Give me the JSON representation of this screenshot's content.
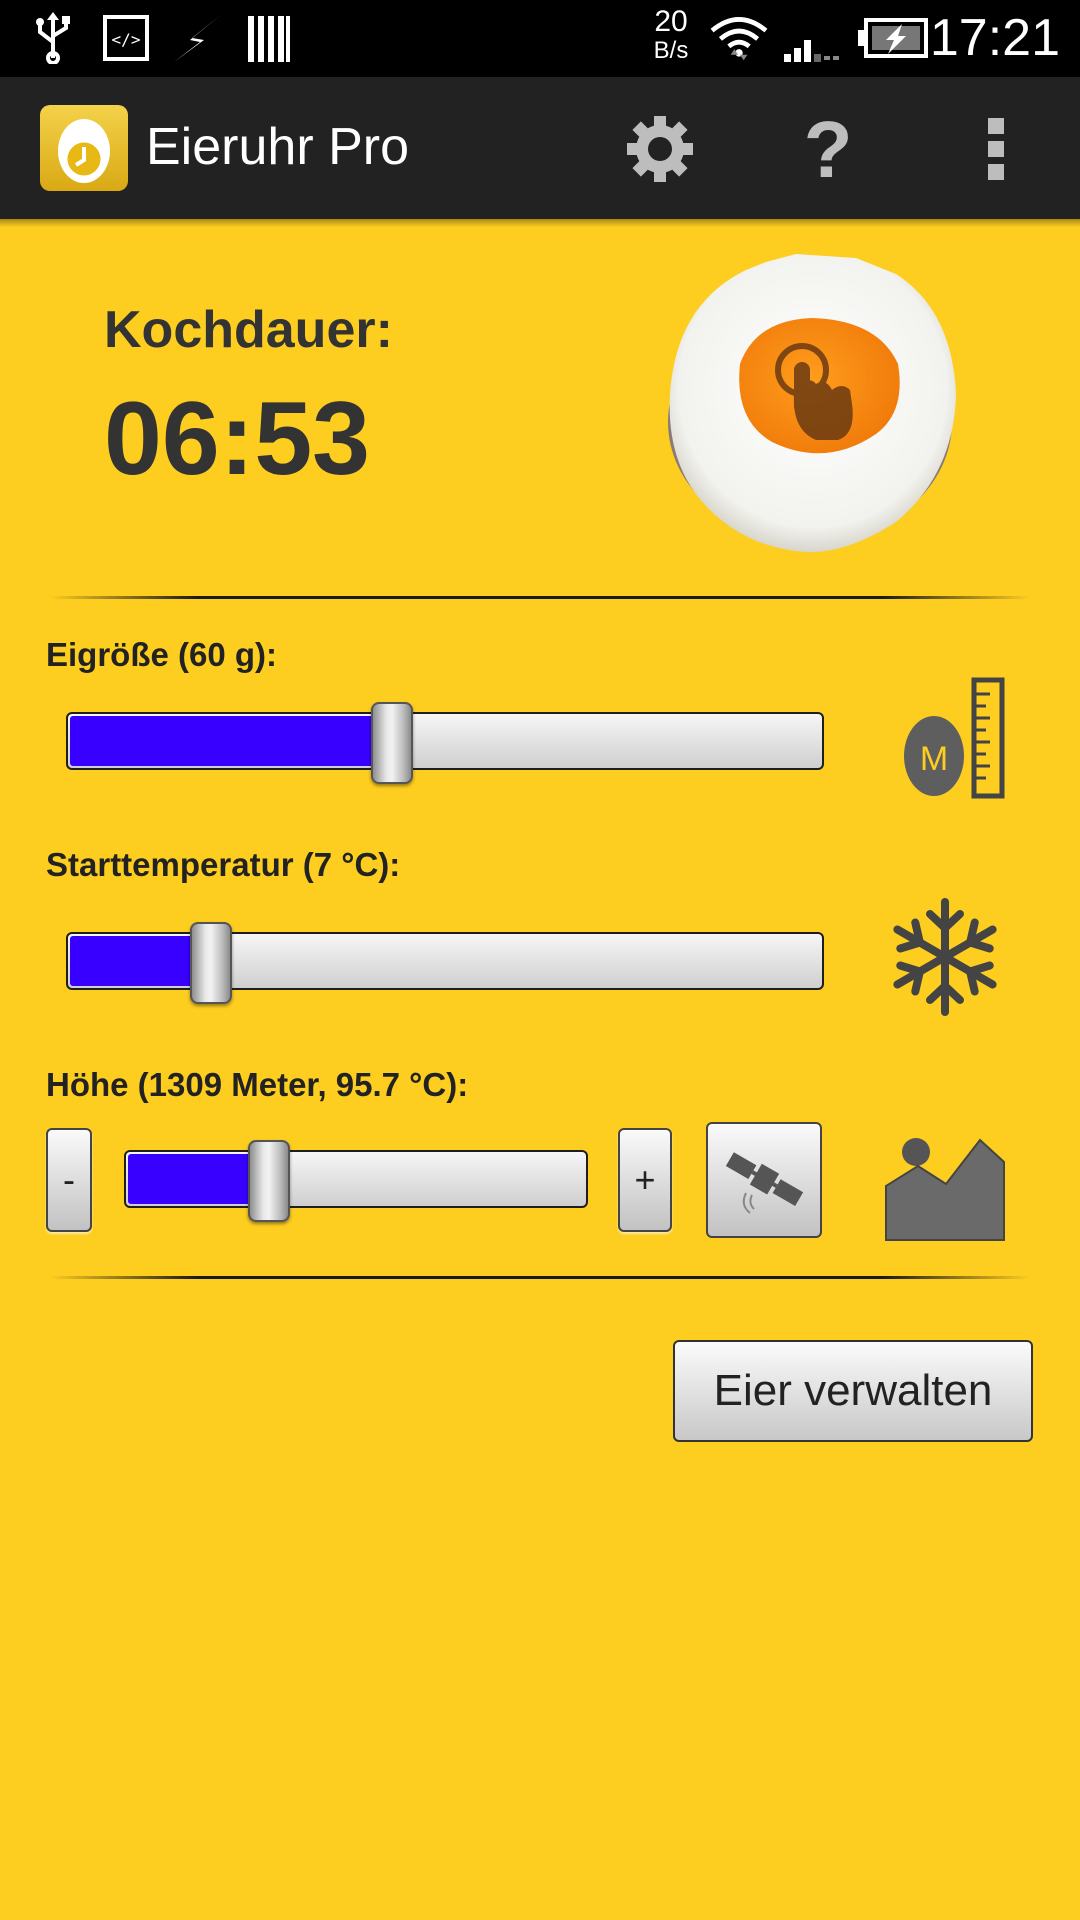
{
  "status_bar": {
    "data_rate_value": "20",
    "data_rate_unit": "B/s",
    "time": "17:21",
    "icons": [
      "usb-icon",
      "code-icon",
      "flash-icon",
      "barcode-icon",
      "wifi-icon",
      "signal-icon",
      "battery-icon"
    ]
  },
  "action_bar": {
    "title": "Eieruhr Pro",
    "icons": [
      "app-icon",
      "settings-gear-icon",
      "help-icon",
      "overflow-menu-icon"
    ]
  },
  "cooking": {
    "label": "Kochdauer:",
    "time": "06:53"
  },
  "settings": {
    "egg_size": {
      "label": "Eigröße (60 g):",
      "slider_fraction": 0.43,
      "icon_letter": "M"
    },
    "start_temp": {
      "label": "Starttemperatur (7 °C):",
      "slider_fraction": 0.19
    },
    "altitude": {
      "label": "Höhe (1309 Meter, 95.7 °C):",
      "slider_fraction": 0.31,
      "minus_label": "-",
      "plus_label": "+"
    }
  },
  "manage_button": {
    "label": "Eier verwalten"
  },
  "colors": {
    "background": "#fdcd20",
    "slider_fill": "#3700ff",
    "action_bar": "#222222",
    "status_bar": "#000000",
    "text_dark": "#333333"
  }
}
